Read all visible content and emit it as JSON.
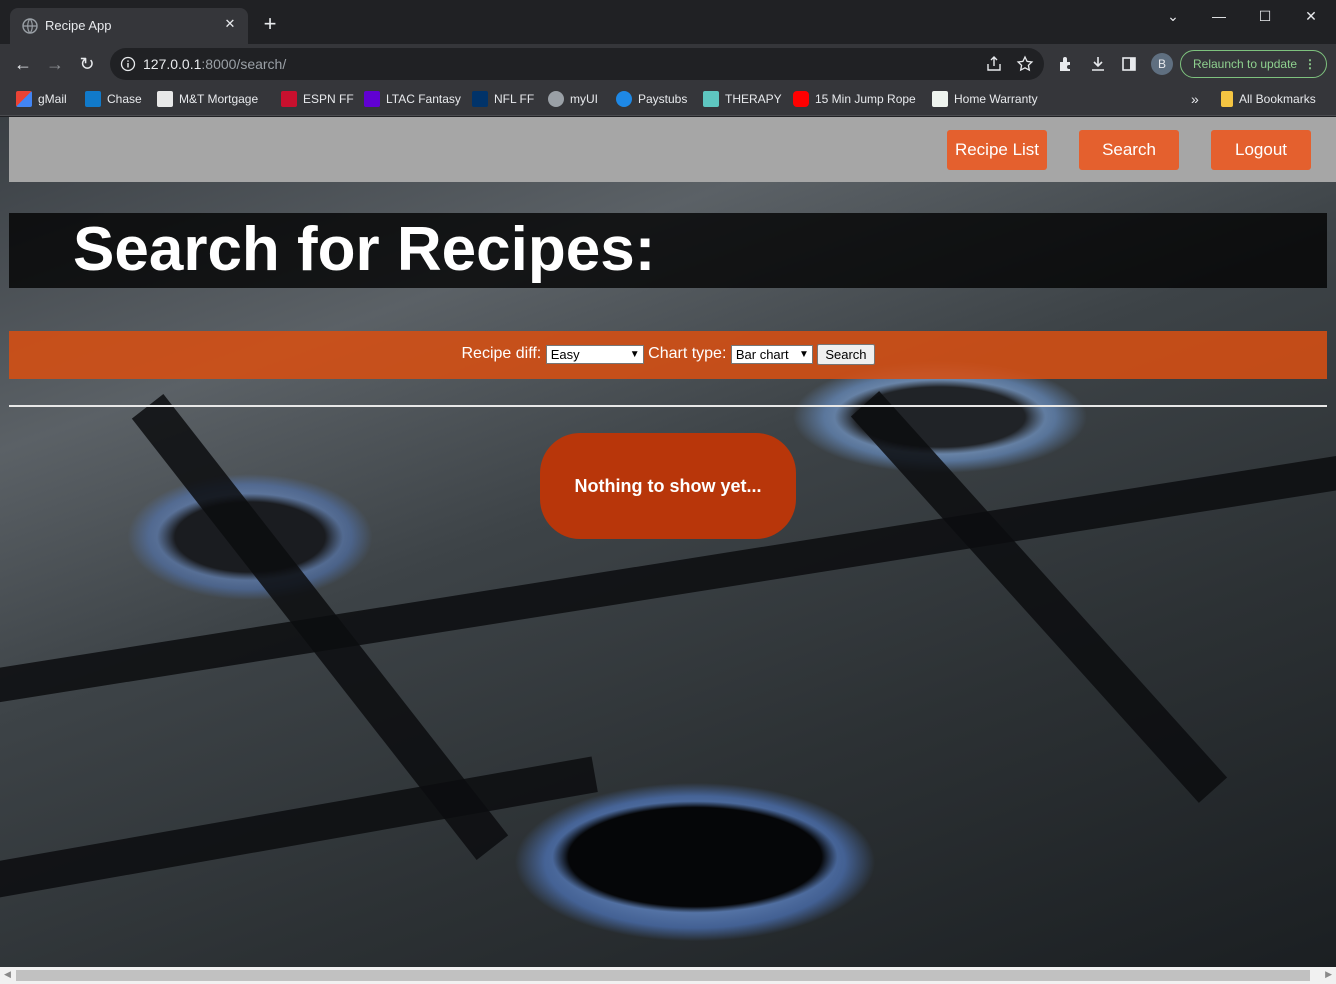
{
  "browser": {
    "tab_title": "Recipe App",
    "url_host": "127.0.0.1",
    "url_path": ":8000/search/",
    "profile_initial": "B",
    "relaunch_label": "Relaunch to update",
    "bookmarks": [
      {
        "label": "gMail",
        "icon": "gmail-icon"
      },
      {
        "label": "Chase",
        "icon": "chase-icon"
      },
      {
        "label": "M&T Mortgage",
        "icon": "mt-icon"
      },
      {
        "label": "ESPN FF",
        "icon": "espn-icon"
      },
      {
        "label": "LTAC Fantasy",
        "icon": "yahoo-icon"
      },
      {
        "label": "NFL FF",
        "icon": "nfl-icon"
      },
      {
        "label": "myUI",
        "icon": "globe-icon"
      },
      {
        "label": "Paystubs",
        "icon": "paystubs-icon"
      },
      {
        "label": "THERAPY",
        "icon": "therapy-icon"
      },
      {
        "label": "15 Min Jump Rope",
        "icon": "youtube-icon"
      },
      {
        "label": "Home Warranty",
        "icon": "warranty-icon"
      }
    ],
    "more_bookmarks": "»",
    "all_bookmarks": "All Bookmarks"
  },
  "nav": {
    "recipe_list": "Recipe List",
    "search": "Search",
    "logout": "Logout"
  },
  "page": {
    "heading": "Search for Recipes:",
    "form": {
      "difficulty_label": "Recipe diff:",
      "difficulty_value": "Easy",
      "chart_label": "Chart type:",
      "chart_value": "Bar chart",
      "submit": "Search"
    },
    "empty_message": "Nothing to show yet..."
  }
}
